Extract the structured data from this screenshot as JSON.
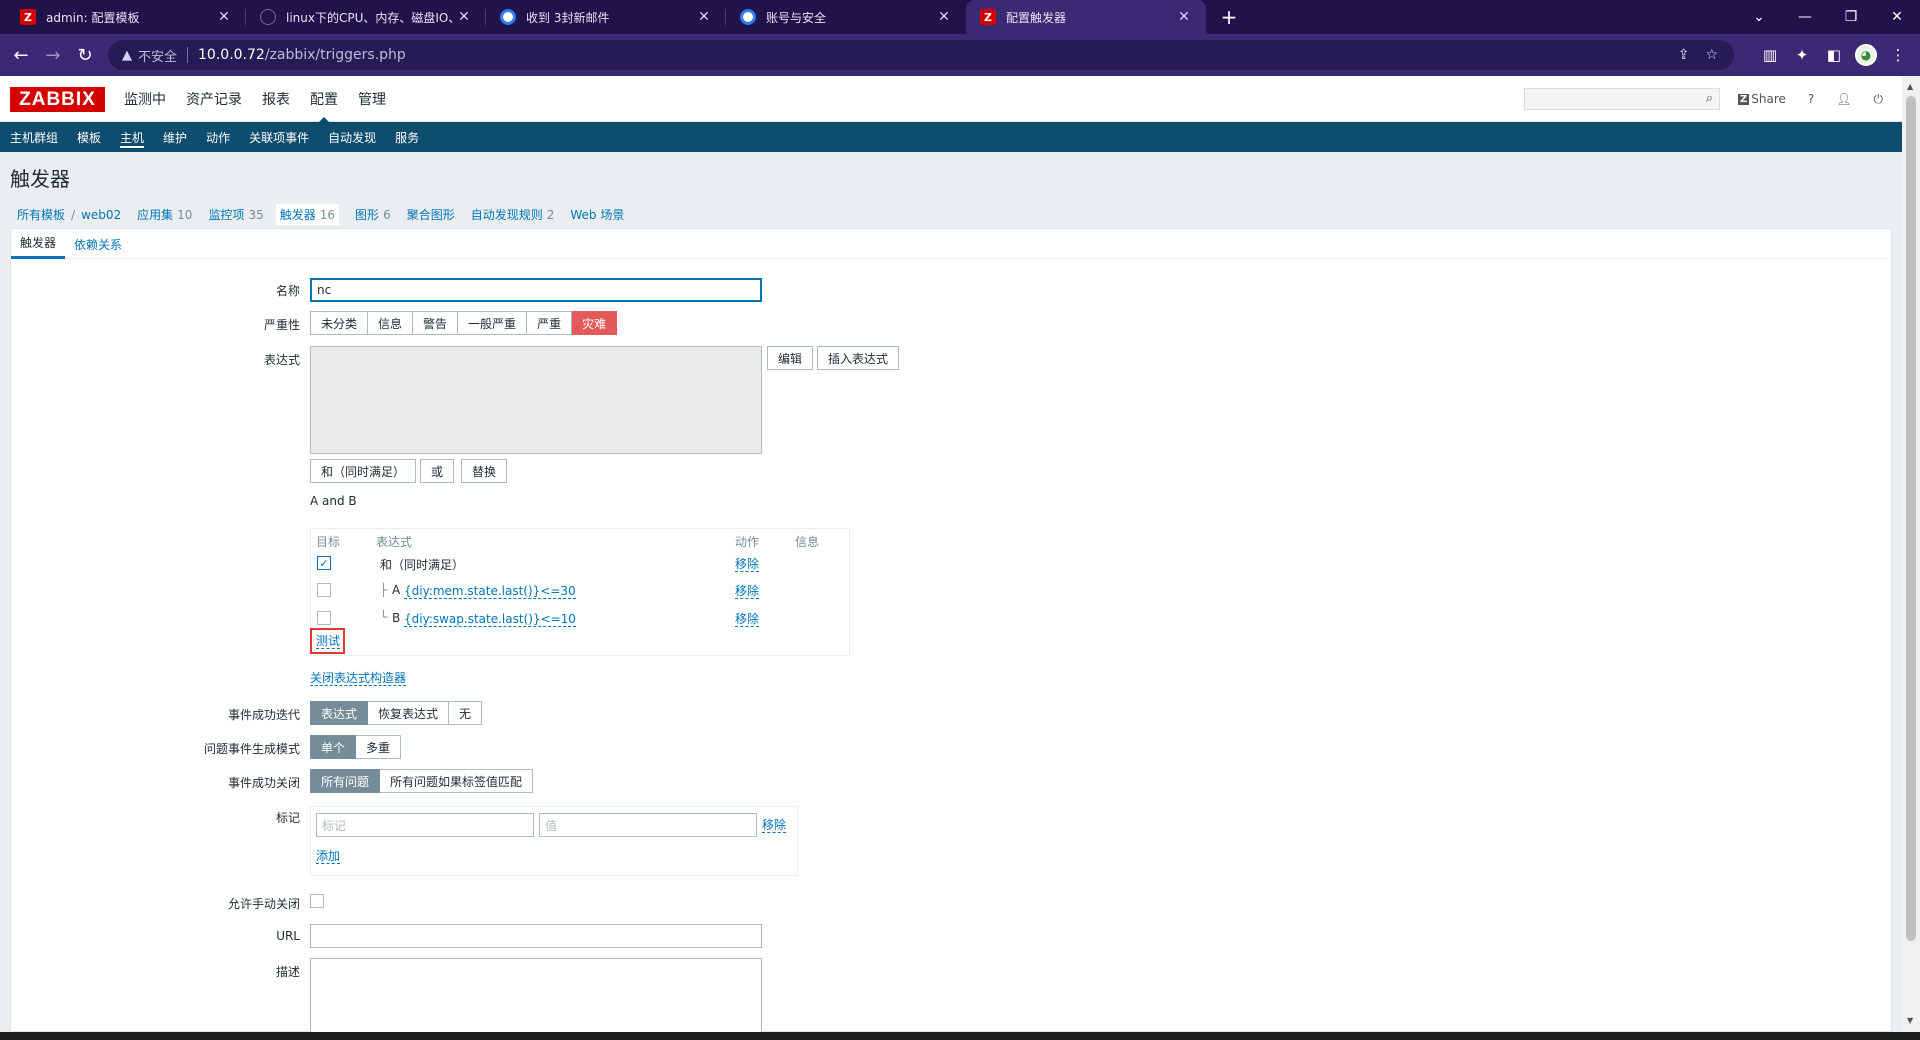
{
  "browser": {
    "tabs": [
      {
        "title": "admin: 配置模板"
      },
      {
        "title": "linux下的CPU、内存、磁盘IO、网络"
      },
      {
        "title": "收到 3封新邮件"
      },
      {
        "title": "账号与安全"
      },
      {
        "title": "配置触发器"
      }
    ],
    "url_warning": "不安全",
    "url_host": "10.0.0.72",
    "url_path": "/zabbix/triggers.php"
  },
  "zabbix": {
    "logo": "ZABBIX",
    "main_menu": [
      "监测中",
      "资产记录",
      "报表",
      "配置",
      "管理"
    ],
    "share": "Share",
    "help": "?",
    "sub_menu": [
      "主机群组",
      "模板",
      "主机",
      "维护",
      "动作",
      "关联项事件",
      "自动发现",
      "服务"
    ],
    "page_title": "触发器",
    "breadcrumbs": {
      "all_templates": "所有模板",
      "host": "web02",
      "apps": "应用集",
      "apps_count": "10",
      "items": "监控项",
      "items_count": "35",
      "triggers": "触发器",
      "triggers_count": "16",
      "graphs": "图形",
      "graphs_count": "6",
      "screens": "聚合图形",
      "discovery": "自动发现规则",
      "discovery_count": "2",
      "web": "Web 场景"
    },
    "form_tabs": [
      "触发器",
      "依赖关系"
    ]
  },
  "form": {
    "name_label": "名称",
    "name_value": "nc",
    "severity_label": "严重性",
    "severity_options": [
      "未分类",
      "信息",
      "警告",
      "一般严重",
      "严重",
      "灾难"
    ],
    "severity_selected": "灾难",
    "expression_label": "表达式",
    "edit_btn": "编辑",
    "insert_btn": "插入表达式",
    "and_btn": "和（同时满足）",
    "or_btn": "或",
    "replace_btn": "替换",
    "expr_text": "A and B",
    "expr_table": {
      "headers": [
        "目标",
        "表达式",
        "动作",
        "信息"
      ],
      "root": "和（同时满足）",
      "rows": [
        {
          "prefix": "A",
          "expr": "{diy:mem.state.last()}<=30"
        },
        {
          "prefix": "B",
          "expr": "{diy:swap.state.last()}<=10"
        }
      ],
      "remove": "移除",
      "test": "测试"
    },
    "close_builder": "关闭表达式构造器",
    "ok_event_label": "事件成功迭代",
    "ok_event_options": [
      "表达式",
      "恢复表达式",
      "无"
    ],
    "problem_mode_label": "问题事件生成模式",
    "problem_mode_options": [
      "单个",
      "多重"
    ],
    "ok_close_label": "事件成功关闭",
    "ok_close_options": [
      "所有问题",
      "所有问题如果标签值匹配"
    ],
    "tags_label": "标记",
    "tag_placeholder": "标记",
    "value_placeholder": "值",
    "tag_remove": "移除",
    "tag_add": "添加",
    "manual_close_label": "允许手动关闭",
    "url_label": "URL",
    "desc_label": "描述"
  }
}
